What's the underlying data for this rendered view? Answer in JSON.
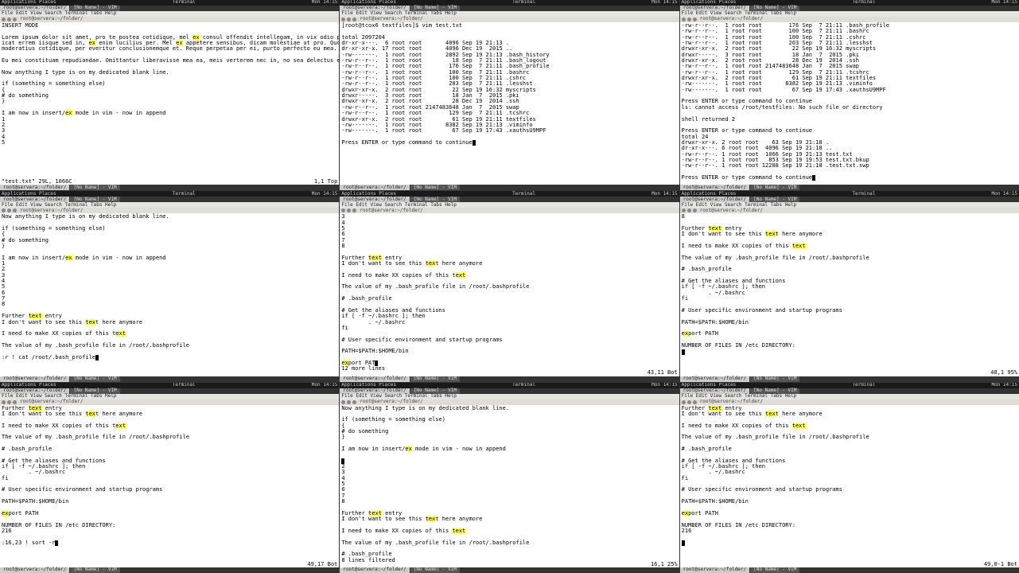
{
  "topbar": {
    "left": "Applications  Places",
    "center": "Terminal",
    "right": "Mon 14:15"
  },
  "menu": "File  Edit  View  Search  Terminal  Tabs  Help",
  "wintitle": "root@servera:~/folder/",
  "tabs": [
    "root@servera:~/folder/",
    "[No Name] - VIM"
  ],
  "panes": [
    {
      "pos": "1,1",
      "ftr": "Top",
      "status": "\"test.txt\" 29L, 1066C",
      "lines": [
        {
          "t": "INSERT MODE"
        },
        {
          "t": ""
        },
        {
          "seg": [
            "Lorem ipsum dolor sit amet, pro te postea cotidique, mel ",
            [
              "ex",
              "hl"
            ],
            " consul offendit intellegam, in vix odio perpetua. D"
          ]
        },
        {
          "seg": [
            "icat errem iisque sed in, ",
            [
              "ex",
              "hl"
            ],
            " enim lucilius per. Mel ",
            [
              "ex",
              "hl"
            ],
            " appetere sensibus, dicam molestiae ut pro. Quo ea nullam"
          ]
        },
        {
          "t": "moderatius cotidique, per everitur conclusionemque et. Reque perpetua per ei, purto perfecto eu mea."
        },
        {
          "t": ""
        },
        {
          "t": "Eu mei constituam repudiandae. Omittantur liberavisse mea ea, meis verterem nec in, no sea delectus erroribus vulputate. Ius quando temporibus et, mei partem alteram an, ei eum quot autem alienum. His tation quaestio ne, pri mazim periculis voluptatum ut, euismod equidem torquatos ut usu. Te mel quis elit dissentias, cu vero eloquentiam eos, vim at vitae euripidis philosophia. Qui delectus adipisci vix, nemore assentior adipiscing ea has."
        },
        {
          "t": ""
        },
        {
          "t": "Now anything I type is on my dedicated blank line."
        },
        {
          "t": ""
        },
        {
          "t": "if (something = something else)"
        },
        {
          "t": "{"
        },
        {
          "t": "# do something"
        },
        {
          "t": "}"
        },
        {
          "t": ""
        },
        {
          "seg": [
            "I am now in insert/",
            [
              "ex",
              "hl"
            ],
            " mode in vim - now in append"
          ]
        },
        {
          "t": "1"
        },
        {
          "t": "2"
        },
        {
          "t": "3"
        },
        {
          "t": "4"
        },
        {
          "t": "5"
        }
      ]
    },
    {
      "lines": [
        {
          "t": "[root@tcox6 textfiles]$ vim test.txt"
        },
        {
          "t": ""
        },
        {
          "t": "total 2097204"
        },
        {
          "t": "dr-xr-x---.  6 root root       4096 Sep 19 21:13 ."
        },
        {
          "t": "dr-xr-xr-x. 17 root root       4096 Dec 19  2015 .."
        },
        {
          "t": "-rw-------.  1 root root       2892 Sep 19 21:13 .bash_history"
        },
        {
          "t": "-rw-r--r--.  1 root root         18 Sep  7 21:11 .bash_logout"
        },
        {
          "t": "-rw-r--r--.  1 root root        176 Sep  7 21:11 .bash_profile"
        },
        {
          "t": "-rw-r--r--.  1 root root        100 Sep  7 21:11 .bashrc"
        },
        {
          "t": "-rw-r--r--.  1 root root        100 Sep  7 21:11 .cshrc"
        },
        {
          "t": "-rw-r--r--.  1 root root        203 Sep  7 21:11 .lesshst"
        },
        {
          "t": "drwxr-xr-x.  2 root root         22 Sep 19 16:32 myscripts"
        },
        {
          "t": "drwxr-----.  3 root root         18 Jan  7  2015 .pki"
        },
        {
          "t": "drwxr-xr-x.  2 root root         28 Dec 19  2014 .ssh"
        },
        {
          "t": "-rw-r--r--.  1 root root 2147483648 Jan  7  2015 swap"
        },
        {
          "t": "-rw-r--r--.  1 root root        129 Sep  7 21:11 .tcshrc"
        },
        {
          "t": "drwxr-xr-x.  2 root root         61 Sep 19 21:11 textfiles"
        },
        {
          "t": "-rw-------.  1 root root       8382 Sep 19 21:13 .viminfo"
        },
        {
          "t": "-rw-------.  1 root root         67 Sep 19 17:43 .xauthsU9MPF"
        },
        {
          "t": ""
        },
        {
          "seg": [
            "Press ENTER or type command to continue",
            [
              "",
              "cursor"
            ]
          ]
        }
      ]
    },
    {
      "lines": [
        {
          "t": "-rw-r--r--.  1 root root        176 Sep  7 21:11 .bash_profile"
        },
        {
          "t": "-rw-r--r--.  1 root root        100 Sep  7 21:11 .bashrc"
        },
        {
          "t": "-rw-r--r--.  1 root root        100 Sep  7 21:11 .cshrc"
        },
        {
          "t": "-rw-r--r--.  1 root root        203 Sep  7 21:11 .lesshst"
        },
        {
          "t": "drwxr-xr-x.  2 root root         22 Sep 19 16:32 myscripts"
        },
        {
          "t": "drwxr-----.  3 root root         18 Jan  7  2015 .pki"
        },
        {
          "t": "drwxr-xr-x.  2 root root         28 Dec 19  2014 .ssh"
        },
        {
          "t": "-rw-r--r--.  1 root root 2147483648 Jan  7  2015 swap"
        },
        {
          "t": "-rw-r--r--.  1 root root        129 Sep  7 21:11 .tcshrc"
        },
        {
          "t": "drwxr-xr-x.  2 root root         61 Sep 19 21:11 textfiles"
        },
        {
          "t": "-rw-------.  1 root root       8382 Sep 19 21:13 .viminfo"
        },
        {
          "t": "-rw-------.  1 root root         67 Sep 19 17:43 .xauthsU9MPF"
        },
        {
          "t": ""
        },
        {
          "t": "Press ENTER or type command to continue"
        },
        {
          "t": "ls: cannot access /root/testfiles: No such file or directory"
        },
        {
          "t": ""
        },
        {
          "t": "shell returned 2"
        },
        {
          "t": ""
        },
        {
          "t": "Press ENTER or type command to continue"
        },
        {
          "t": "total 24"
        },
        {
          "t": "drwxr-xr-x. 2 root root    63 Sep 19 21:18 ."
        },
        {
          "t": "dr-xr-x---. 6 root root  4096 Sep 19 21:18 .."
        },
        {
          "t": "-rw-r--r--. 1 root root  1066 Sep 19 21:13 test.txt"
        },
        {
          "t": "-rw-r--r--. 1 root root   853 Sep 19 19:53 test.txt.bkup"
        },
        {
          "t": "-rw-r--r--. 1 root root 12288 Sep 19 21:18 .test.txt.swp"
        },
        {
          "t": ""
        },
        {
          "seg": [
            "Press ENTER or type command to continue",
            [
              "",
              "cursor"
            ]
          ]
        }
      ]
    },
    {
      "lines": [
        {
          "t": "Now anything I type is on my dedicated blank line."
        },
        {
          "t": ""
        },
        {
          "t": "if (something = something else)"
        },
        {
          "t": "{"
        },
        {
          "t": "# do something"
        },
        {
          "t": "}"
        },
        {
          "t": ""
        },
        {
          "seg": [
            "I am now in insert/",
            [
              "ex",
              "hl"
            ],
            " mode in vim - now in append"
          ]
        },
        {
          "t": "1"
        },
        {
          "t": "2"
        },
        {
          "t": "3"
        },
        {
          "t": "4"
        },
        {
          "t": "5"
        },
        {
          "t": "6"
        },
        {
          "t": "7"
        },
        {
          "t": "8"
        },
        {
          "t": ""
        },
        {
          "seg": [
            "Further ",
            [
              "text",
              "hl"
            ],
            " entry"
          ]
        },
        {
          "seg": [
            "I don't want to see this ",
            [
              "tex",
              "hl"
            ],
            "t here anymore"
          ]
        },
        {
          "t": ""
        },
        {
          "seg": [
            "I need to make XX copies of this t",
            [
              "ext",
              "hl"
            ]
          ]
        },
        {
          "t": ""
        },
        {
          "t": "The value of my .bash_profile file in /root/.bashprofile"
        },
        {
          "t": ""
        },
        {
          "seg": [
            ":r ! cat /root/.bash_profile",
            [
              "",
              "cursor"
            ]
          ]
        }
      ]
    },
    {
      "pos": "43,11",
      "ftr": "Bot",
      "lines": [
        {
          "t": "3"
        },
        {
          "t": "4"
        },
        {
          "t": "5"
        },
        {
          "t": "6"
        },
        {
          "t": "7"
        },
        {
          "t": "8"
        },
        {
          "t": ""
        },
        {
          "seg": [
            "Further ",
            [
              "text",
              "hl"
            ],
            " entry"
          ]
        },
        {
          "seg": [
            "I don't want to see this ",
            [
              "tex",
              "hl"
            ],
            "t here anymore"
          ]
        },
        {
          "t": ""
        },
        {
          "seg": [
            "I need to make XX copies of this t",
            [
              "ext",
              "hl"
            ]
          ]
        },
        {
          "t": ""
        },
        {
          "t": "The value of my .bash_profile file in /root/.bashprofile"
        },
        {
          "t": ""
        },
        {
          "t": "# .bash_profile"
        },
        {
          "t": ""
        },
        {
          "t": "# Get the aliases and functions"
        },
        {
          "t": "if [ -f ~/.bashrc ]; then"
        },
        {
          "t": "        . ~/.bashrc"
        },
        {
          "t": "fi"
        },
        {
          "t": ""
        },
        {
          "t": "# User specific environment and startup programs"
        },
        {
          "t": ""
        },
        {
          "t": "PATH=$PATH:$HOME/bin"
        },
        {
          "t": ""
        },
        {
          "seg": [
            [
              "ex",
              "hl"
            ],
            "port PAT",
            [
              "",
              "cursor"
            ]
          ]
        },
        {
          "t": "12 more lines"
        }
      ]
    },
    {
      "pos": "48,1",
      "ftr": "95%",
      "lines": [
        {
          "t": "8"
        },
        {
          "t": ""
        },
        {
          "seg": [
            "Further ",
            [
              "text",
              "hl"
            ],
            " entry"
          ]
        },
        {
          "seg": [
            "I don't want to see this ",
            [
              "tex",
              "hl"
            ],
            "t here anymore"
          ]
        },
        {
          "t": ""
        },
        {
          "seg": [
            "I need to make XX copies of this ",
            [
              "text",
              "hl"
            ]
          ]
        },
        {
          "t": ""
        },
        {
          "t": "The value of my .bash_profile file in /root/.bashprofile"
        },
        {
          "t": ""
        },
        {
          "t": "# .bash_profile"
        },
        {
          "t": ""
        },
        {
          "t": "# Get the aliases and functions"
        },
        {
          "t": "if [ -f ~/.bashrc ]; then"
        },
        {
          "t": "        . ~/.bashrc"
        },
        {
          "t": "fi"
        },
        {
          "t": ""
        },
        {
          "t": "# User specific environment and startup programs"
        },
        {
          "t": ""
        },
        {
          "t": "PATH=$PATH:$HOME/bin"
        },
        {
          "t": ""
        },
        {
          "seg": [
            [
              "ex",
              "hl"
            ],
            "port PATH"
          ]
        },
        {
          "t": ""
        },
        {
          "t": "NUMBER OF FILES IN /etc DIRECTORY:"
        },
        {
          "seg": [
            [
              "",
              "cursor"
            ]
          ]
        }
      ]
    },
    {
      "pos": "49,17",
      "ftr": "Bot",
      "lines": [
        {
          "seg": [
            "Further ",
            [
              "text",
              "hl"
            ],
            " entry"
          ]
        },
        {
          "seg": [
            "I don't want to see this ",
            [
              "tex",
              "hl"
            ],
            "t here anymore"
          ]
        },
        {
          "t": ""
        },
        {
          "seg": [
            "I need to make XX copies of this t",
            [
              "ext",
              "hl"
            ]
          ]
        },
        {
          "t": ""
        },
        {
          "t": "The value of my .bash_profile file in /root/.bashprofile"
        },
        {
          "t": ""
        },
        {
          "t": "# .bash_profile"
        },
        {
          "t": ""
        },
        {
          "t": "# Get the aliases and functions"
        },
        {
          "t": "if [ -f ~/.bashrc ]; then"
        },
        {
          "t": "        . ~/.bashrc"
        },
        {
          "t": "fi"
        },
        {
          "t": ""
        },
        {
          "t": "# User specific environment and startup programs"
        },
        {
          "t": ""
        },
        {
          "t": "PATH=$PATH:$HOME/bin"
        },
        {
          "t": ""
        },
        {
          "seg": [
            [
              "ex",
              "hl"
            ],
            "port PATH"
          ]
        },
        {
          "t": ""
        },
        {
          "t": "NUMBER OF FILES IN /etc DIRECTORY:"
        },
        {
          "t": "216"
        },
        {
          "t": ""
        },
        {
          "seg": [
            ":16,23 ! sort -r",
            [
              "",
              "cursor"
            ]
          ]
        }
      ]
    },
    {
      "pos": "16,1",
      "ftr": "25%",
      "lines": [
        {
          "t": "Now anything I type is on my dedicated blank line."
        },
        {
          "t": ""
        },
        {
          "t": "if (something = something else)"
        },
        {
          "t": "{"
        },
        {
          "t": "# do something"
        },
        {
          "t": "}"
        },
        {
          "t": ""
        },
        {
          "seg": [
            "I am now in insert/",
            [
              "ex",
              "hl"
            ],
            " mode in vim - now in append"
          ]
        },
        {
          "t": ""
        },
        {
          "seg": [
            [
              "",
              "cursor"
            ]
          ]
        },
        {
          "t": "2"
        },
        {
          "t": "3"
        },
        {
          "t": "4"
        },
        {
          "t": "5"
        },
        {
          "t": "6"
        },
        {
          "t": "7"
        },
        {
          "t": "8"
        },
        {
          "t": ""
        },
        {
          "seg": [
            "Further ",
            [
              "text",
              "hl"
            ],
            " entry"
          ]
        },
        {
          "seg": [
            "I don't want to see this ",
            [
              "tex",
              "hl"
            ],
            "t here anymore"
          ]
        },
        {
          "t": ""
        },
        {
          "seg": [
            "I need to make XX copies of this ",
            [
              "text",
              "hl"
            ]
          ]
        },
        {
          "t": ""
        },
        {
          "t": "The value of my .bash_profile file in /root/.bashprofile"
        },
        {
          "t": ""
        },
        {
          "t": "# .bash_profile"
        },
        {
          "t": "8 lines filtered"
        }
      ]
    },
    {
      "pos": "49,0-1",
      "ftr": "Bot",
      "lines": [
        {
          "seg": [
            "Further ",
            [
              "text",
              "hl"
            ],
            " entry"
          ]
        },
        {
          "seg": [
            "I don't want to see this ",
            [
              "tex",
              "hl"
            ],
            "t here anymore"
          ]
        },
        {
          "t": ""
        },
        {
          "seg": [
            "I need to make XX copies of this ",
            [
              "text",
              "hl"
            ]
          ]
        },
        {
          "t": ""
        },
        {
          "t": "The value of my .bash_profile file in /root/.bashprofile"
        },
        {
          "t": ""
        },
        {
          "t": "# .bash_profile"
        },
        {
          "t": ""
        },
        {
          "t": "# Get the aliases and functions"
        },
        {
          "t": "if [ -f ~/.bashrc ]; then"
        },
        {
          "t": "        . ~/.bashrc"
        },
        {
          "t": "fi"
        },
        {
          "t": ""
        },
        {
          "t": "# User specific environment and startup programs"
        },
        {
          "t": ""
        },
        {
          "t": "PATH=$PATH:$HOME/bin"
        },
        {
          "t": ""
        },
        {
          "seg": [
            [
              "ex",
              "hl"
            ],
            "port PATH"
          ]
        },
        {
          "t": ""
        },
        {
          "t": "NUMBER OF FILES IN /etc DIRECTORY:"
        },
        {
          "t": "216"
        },
        {
          "t": ""
        },
        {
          "seg": [
            [
              "",
              "cursor"
            ]
          ]
        }
      ]
    }
  ]
}
